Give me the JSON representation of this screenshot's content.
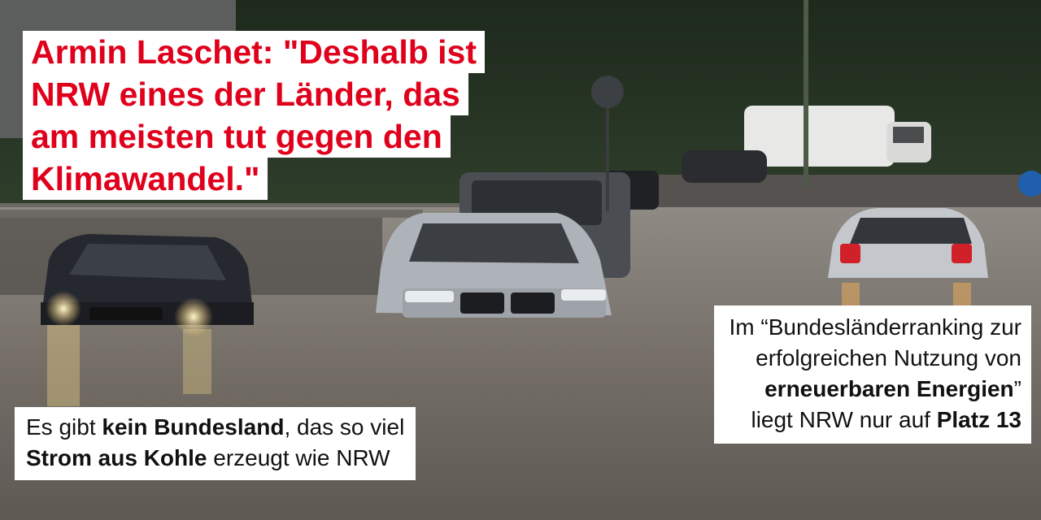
{
  "quote": {
    "lines": [
      "Armin Laschet: \"Deshalb ist",
      "NRW eines der Länder, das",
      "am meisten tut gegen den",
      "Klimawandel.\""
    ]
  },
  "fact_left": {
    "line1_before": "Es gibt ",
    "line1_bold": "kein Bundesland",
    "line1_after": ", das so viel",
    "line2_bold": "Strom aus Kohle",
    "line2_after": " erzeugt wie NRW"
  },
  "fact_right": {
    "line1": "Im “Bundesländerranking zur",
    "line2": "erfolgreichen Nutzung von",
    "line3_bold": "erneuerbaren Energien",
    "line3_after": "”",
    "line4_before": "liegt NRW nur auf ",
    "line4_bold": "Platz 13"
  },
  "colors": {
    "quote_text": "#e0001b",
    "caption_bg": "#ffffff",
    "caption_text": "#111111"
  }
}
